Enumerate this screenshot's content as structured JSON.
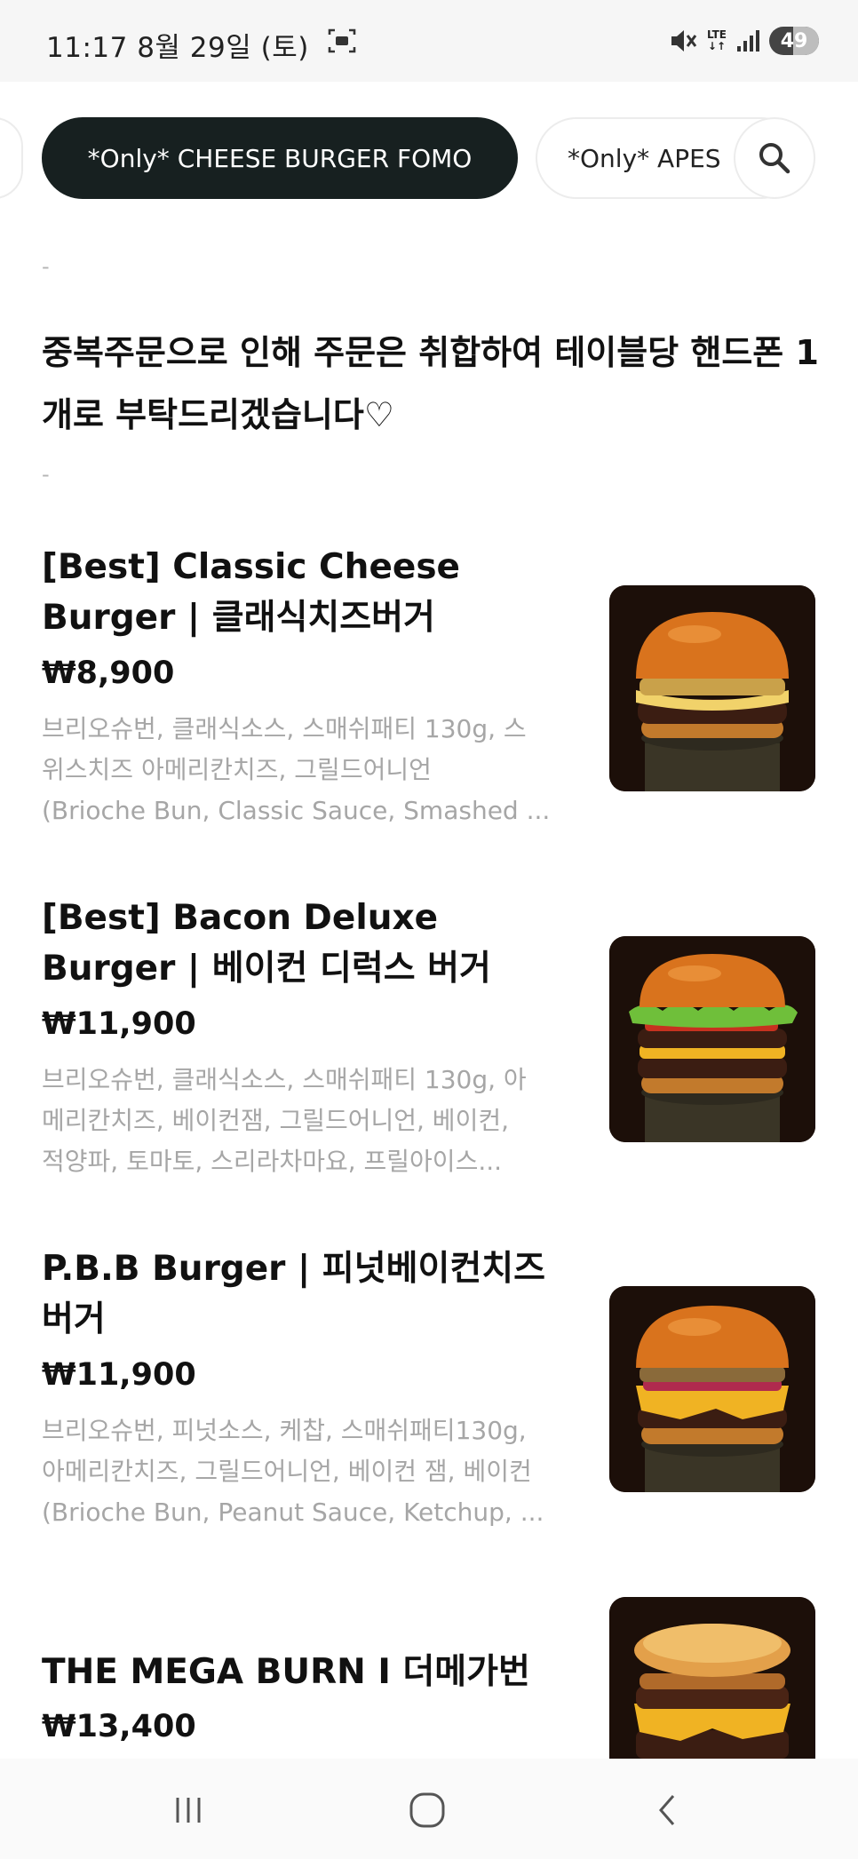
{
  "status_bar": {
    "time_date": "11:17  8월 29일 (토)",
    "network": "LTE",
    "battery": "49",
    "battery_level": 0.49
  },
  "tabs": {
    "active_label": "*Only* CHEESE BURGER FOMO",
    "next_label": "*Only* APES"
  },
  "notice": {
    "dash_top": "-",
    "text": "중복주문으로 인해 주문은 취합하여 테이블당 핸드폰 1개로 부탁드리겠습니다♡",
    "dash_bottom": "-"
  },
  "menu_items": [
    {
      "name": "[Best] Classic Cheese Burger | 클래식치즈버거",
      "price": "₩8,900",
      "description": "브리오슈번, 클래식소스, 스매쉬패티 130g, 스\n위스치즈 아메리칸치즈, 그릴드어니언\n(Brioche Bun, Classic Sauce, Smashed ..."
    },
    {
      "name": "[Best] Bacon Deluxe Burger | 베이컨 디럭스 버거",
      "price": "₩11,900",
      "description": "브리오슈번, 클래식소스, 스매쉬패티 130g, 아\n메리칸치즈, 베이컨잼, 그릴드어니언, 베이컨,\n적양파, 토마토, 스리라차마요, 프릴아이스..."
    },
    {
      "name": "P.B.B Burger | 피넛베이컨치즈 버거",
      "price": "₩11,900",
      "description": "브리오슈번, 피넛소스, 케찹, 스매쉬패티130g,\n아메리칸치즈, 그릴드어니언, 베이컨 잼, 베이컨\n(Brioche Bun, Peanut Sauce, Ketchup, ..."
    },
    {
      "name": "THE MEGA BURN I 더메가번",
      "price": "₩13,400",
      "description": ""
    }
  ]
}
